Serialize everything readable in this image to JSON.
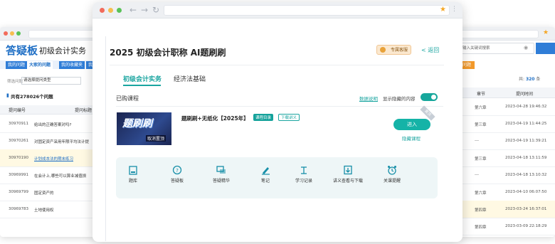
{
  "left_window": {
    "brand": "答疑板",
    "course": "初级会计实务",
    "tabs": [
      "我的问题",
      "大家的问题",
      "我的收藏夹",
      "我"
    ],
    "filter_label": "筛选问题",
    "filter_value": "请选择提问类型",
    "count_text": "共有278026个问题",
    "columns": [
      "提问编号",
      "提问标题"
    ],
    "rows": [
      {
        "id": "30970911",
        "title": "给出的正确答案对吗?"
      },
      {
        "id": "30970261",
        "title": "对固定资产采用年限平均法计提"
      },
      {
        "id": "30970190",
        "title": "计划成本法的期末练习",
        "highlight": true
      },
      {
        "id": "30969991",
        "title": "在会计上,哪些可以算业减值损"
      },
      {
        "id": "30969799",
        "title": "固定资产的"
      },
      {
        "id": "30969783",
        "title": "土地使用权"
      }
    ]
  },
  "right_window": {
    "search_placeholder": "输入关键词搜索",
    "orange_tab": "问题",
    "total_label": "共:",
    "total_value": "320",
    "total_unit": "条",
    "columns": [
      "章节",
      "提问时间"
    ],
    "rows": [
      {
        "chapter": "第六章",
        "time": "2023-04-28 19:46:32"
      },
      {
        "chapter": "第三章",
        "time": "2023-04-19 11:44:25"
      },
      {
        "chapter": "---",
        "time": "2023-04-19 11:39:21"
      },
      {
        "chapter": "第三章",
        "time": "2023-04-18 13:11:59"
      },
      {
        "chapter": "---",
        "time": "2023-04-18 13:10:32"
      },
      {
        "chapter": "第六章",
        "time": "2023-04-10 06:07:50"
      },
      {
        "chapter": "第四章",
        "time": "2023-03-24 16:37:01",
        "highlight": true
      },
      {
        "chapter": "第四章",
        "time": "2023-03-09 22:18:29"
      }
    ]
  },
  "main": {
    "title": "2025 初级会计职称 AI题刷刷",
    "vip_label": "专属客服",
    "back_label": "< 返回",
    "tabs": [
      "初级会计实务",
      "经济法基础"
    ],
    "section_label": "已购课程",
    "data_note_link": "数据说明",
    "show_hidden_label": "显示隐藏的内容",
    "course": {
      "thumb_title": "题刷刷",
      "thumb_sub": "取消置顶",
      "name": "题刷刷+无纸化【2025年】",
      "tag_catalog": "课程目录",
      "tag_download": "下载讲义",
      "ribbon": "置顶",
      "enter_label": "进入",
      "hide_label": "隐藏课程"
    },
    "tools": [
      {
        "label": "题库",
        "icon": "book-icon"
      },
      {
        "label": "答疑板",
        "icon": "question-icon"
      },
      {
        "label": "答疑精华",
        "icon": "chat-icon"
      },
      {
        "label": "笔记",
        "icon": "pen-icon"
      },
      {
        "label": "学习记录",
        "icon": "record-icon"
      },
      {
        "label": "讲义查看与下载",
        "icon": "download-icon"
      },
      {
        "label": "关课提醒",
        "icon": "alarm-icon"
      }
    ]
  },
  "colors": {
    "accent": "#1aa5a0",
    "brand_blue": "#1f6fc5",
    "highlight": "#fff9e3"
  }
}
